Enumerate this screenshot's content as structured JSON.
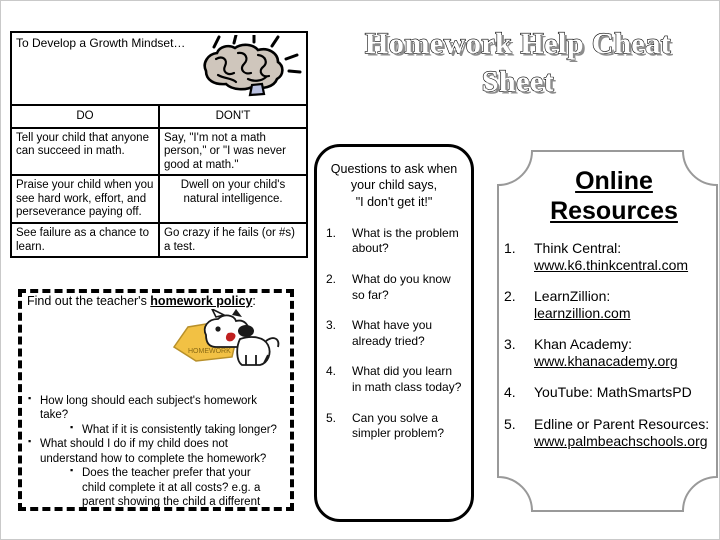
{
  "title": {
    "line1": "Homework Help Cheat",
    "line2": "Sheet"
  },
  "growth_table": {
    "heading": "To Develop a Growth Mindset…",
    "brain_icon": "brain-icon",
    "columns": [
      "DO",
      "DON'T"
    ],
    "rows": [
      {
        "do": "Tell your child that anyone can succeed in math.",
        "dont": "Say, \"I'm not a math person,\" or \"I was never good at math.\""
      },
      {
        "do": "Praise your child when you see hard work, effort, and perseverance paying off.",
        "dont": "Dwell on your child's natural intelligence."
      },
      {
        "do": "See failure as a chance to learn.",
        "dont": "Go crazy if he fails (or #s) a test."
      }
    ]
  },
  "policy_box": {
    "title_prefix": "Find out the teacher's ",
    "title_bold": "homework policy",
    "title_suffix": ":",
    "dog_icon": "dog-eating-homework-icon",
    "items": [
      {
        "level": 1,
        "text": "How long should each subject's homework take?"
      },
      {
        "level": 2,
        "text": "What if it is consistently taking longer?"
      },
      {
        "level": 1,
        "text": "What should I do if my child does not understand how to complete the homework?"
      },
      {
        "level": 2,
        "text": "Does the teacher prefer that your"
      },
      {
        "level": 0,
        "text": "child complete it at all costs? e.g. a"
      },
      {
        "level": 0,
        "text": "parent showing the child a different"
      }
    ]
  },
  "questions_box": {
    "heading_lines": [
      "Questions to ask when",
      "your child says,",
      "\"I don't get it!\""
    ],
    "items": [
      {
        "num": "1.",
        "text": "What is the problem about?"
      },
      {
        "num": "2.",
        "text": "What do you know so far?"
      },
      {
        "num": "3.",
        "text": "What have you already tried?"
      },
      {
        "num": "4.",
        "text": "What did you learn in math class today?"
      },
      {
        "num": "5.",
        "text": "Can you solve a simpler problem?"
      }
    ]
  },
  "resources_panel": {
    "title_line1": "Online",
    "title_line2": "Resources",
    "border_color": "#999999",
    "items": [
      {
        "num": "1.",
        "label": "Think Central:",
        "url": "www.k6.thinkcentral.com"
      },
      {
        "num": "2.",
        "label": "LearnZillion:",
        "url": "learnzillion.com"
      },
      {
        "num": "3.",
        "label": "Khan Academy:",
        "url": "www.khanacademy.org"
      },
      {
        "num": "4.",
        "label": "YouTube: MathSmartsPD",
        "url": ""
      },
      {
        "num": "5.",
        "label": "Edline or Parent Resources:",
        "url": "www.palmbeachschools.org"
      }
    ]
  }
}
